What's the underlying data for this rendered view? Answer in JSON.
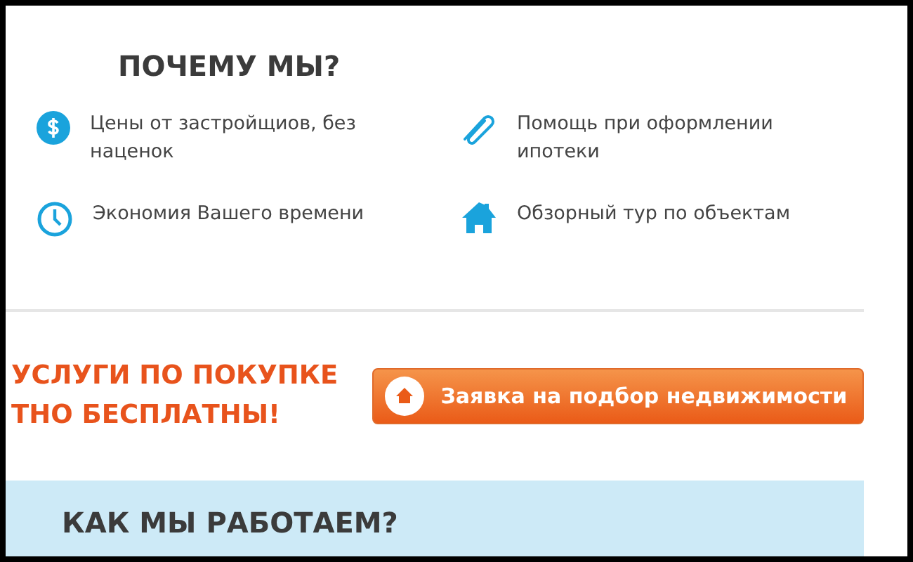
{
  "why_us": {
    "title": "ПОЧЕМУ МЫ?",
    "features": [
      {
        "kind": "dollar",
        "text": "Цены от застройщиов, без наценок"
      },
      {
        "kind": "paperclip",
        "text": "Помощь при оформлении ипотеки"
      },
      {
        "kind": "clock",
        "text": "Экономия Вашего времени"
      },
      {
        "kind": "house",
        "text": "Обзорный тур по объектам"
      }
    ]
  },
  "promo": {
    "lines": [
      "УСЛУГИ ПО ПОКУПКЕ",
      "ТНО БЕСПЛАТНЫ!"
    ],
    "button": "Заявка на подбор недвижимости"
  },
  "how_we_work": {
    "title": "КАК МЫ РАБОТАЕМ?"
  }
}
